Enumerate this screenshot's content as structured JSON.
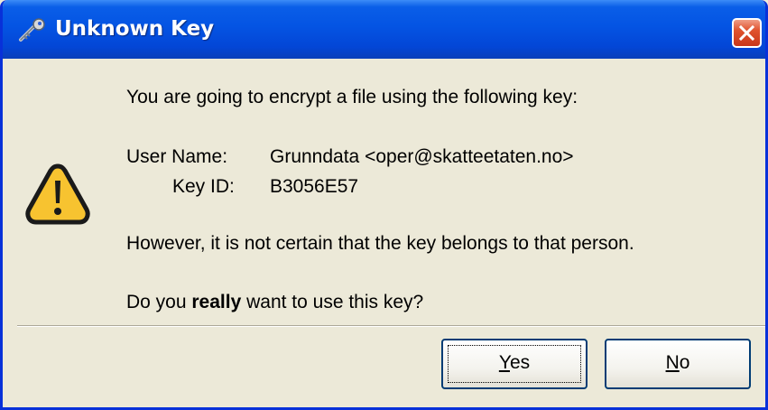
{
  "window": {
    "title": "Unknown Key",
    "icon": "key-icon",
    "close_icon": "close-icon"
  },
  "dialog": {
    "icon": "warning-icon",
    "intro": "You are going to encrypt a file using the following key:",
    "user_name_label": "User Name:",
    "user_name_value": "Grunndata <oper@skatteetaten.no>",
    "key_id_label": "Key ID:",
    "key_id_value": "B3056E57",
    "warning": "However, it is not certain that the key belongs to that person.",
    "question_prefix": "Do you ",
    "question_emphasis": "really",
    "question_suffix": " want to use this key?"
  },
  "buttons": {
    "yes_mnemonic": "Y",
    "yes_rest": "es",
    "no_mnemonic": "N",
    "no_rest": "o"
  },
  "colors": {
    "titlebar": "#0454e3",
    "frame": "#0831d9",
    "dialog_bg": "#ece9d8",
    "warning_fill": "#f7c330",
    "close_button": "#e0532e"
  }
}
